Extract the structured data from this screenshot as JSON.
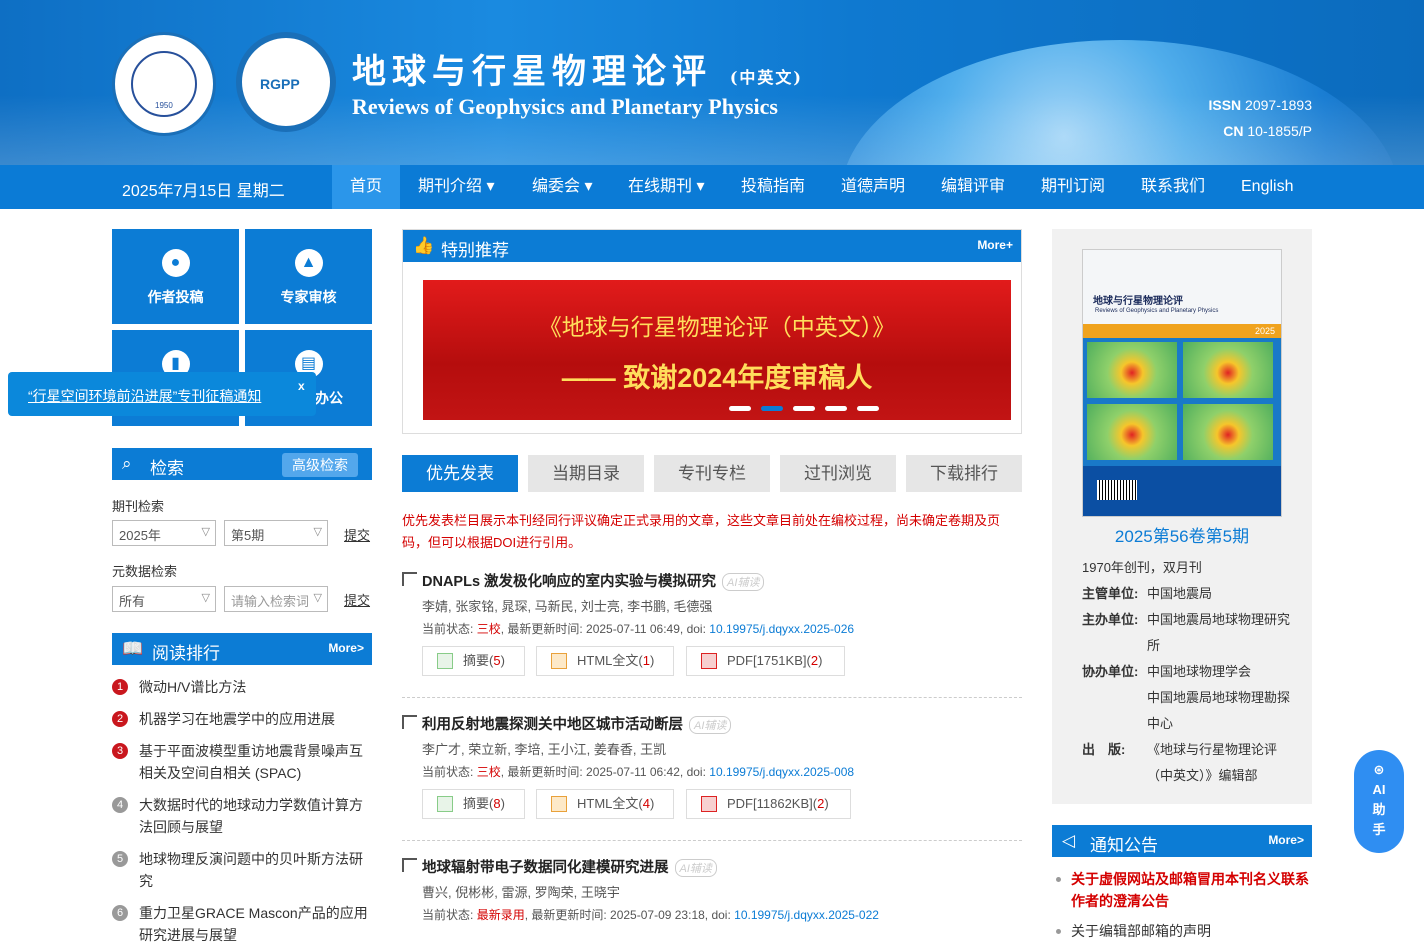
{
  "header": {
    "title_cn": "地球与行星物理论评",
    "title_cn_suffix": "(中英文)",
    "title_en": "Reviews of Geophysics and Planetary Physics",
    "logo_text": "RGPP",
    "seal_year": "1950",
    "issn_label": "ISSN",
    "issn_value": "2097-1893",
    "cn_label": "CN",
    "cn_value": "10-1855/P"
  },
  "nav": {
    "date": "2025年7月15日 星期二",
    "items": [
      "首页",
      "期刊介绍 ▾",
      "编委会 ▾",
      "在线期刊 ▾",
      "投稿指南",
      "道德声明",
      "编辑评审",
      "期刊订阅",
      "联系我们",
      "English"
    ]
  },
  "quick_tiles": [
    "作者投稿",
    "专家审核",
    "",
    "办公"
  ],
  "popup": {
    "text": "“行星空间环境前沿进展”专刊征稿通知",
    "close": "x"
  },
  "search": {
    "title": "检索",
    "advanced": "高级检索",
    "period_label": "期刊检索",
    "year_value": "2025年",
    "issue_value": "第5期",
    "submit": "提交",
    "meta_label": "元数据检索",
    "field_value": "所有",
    "keyword_placeholder": "请输入检索词",
    "submit2": "提交"
  },
  "reading_rank": {
    "title": "阅读排行",
    "more": "More>",
    "items": [
      {
        "n": "1",
        "t": "微动H/V谱比方法"
      },
      {
        "n": "2",
        "t": "机器学习在地震学中的应用进展"
      },
      {
        "n": "3",
        "t": "基于平面波模型重访地震背景噪声互相关及空间自相关 (SPAC)"
      },
      {
        "n": "4",
        "t": "大数据时代的地球动力学数值计算方法回顾与展望"
      },
      {
        "n": "5",
        "t": "地球物理反演问题中的贝叶斯方法研究"
      },
      {
        "n": "6",
        "t": "重力卫星GRACE Mascon产品的应用研究进展与展望"
      }
    ]
  },
  "featured": {
    "title": "特别推荐",
    "more": "More+",
    "slide_line1": "《地球与行星物理论评（中英文）》",
    "slide_line2": "—— 致谢2024年度审稿人"
  },
  "tabs": [
    "优先发表",
    "当期目录",
    "专刊专栏",
    "过刊浏览",
    "下载排行"
  ],
  "notice": "优先发表栏目展示本刊经同行评议确定正式录用的文章，这些文章目前处在编校过程，尚未确定卷期及页码，但可以根据DOI进行引用。",
  "articles": [
    {
      "title": "DNAPLs 激发极化响应的室内实验与模拟研究",
      "ai": "AI辅读",
      "authors": "李婧, 张家铭, 晁琛, 马新民, 刘士亮, 李书鹏, 毛德强",
      "status_label": "当前状态:",
      "status": "三校",
      "updated": ", 最新更新时间: 2025-07-11 06:49, doi:",
      "doi": "10.19975/j.dqyxx.2025-026",
      "abs_label": "摘要(",
      "abs_count": "5",
      "html_label": "HTML全文(",
      "html_count": "1",
      "pdf_label": "PDF[1751KB](",
      "pdf_count": "2"
    },
    {
      "title": "利用反射地震探测关中地区城市活动断层",
      "ai": "AI辅读",
      "authors": "李广才, 荣立新, 李培, 王小江, 姜春香, 王凯",
      "status_label": "当前状态:",
      "status": "三校",
      "updated": ", 最新更新时间: 2025-07-11 06:42, doi:",
      "doi": "10.19975/j.dqyxx.2025-008",
      "abs_label": "摘要(",
      "abs_count": "8",
      "html_label": "HTML全文(",
      "html_count": "4",
      "pdf_label": "PDF[11862KB](",
      "pdf_count": "2"
    },
    {
      "title": "地球辐射带电子数据同化建模研究进展",
      "ai": "AI辅读",
      "authors": "曹兴, 倪彬彬, 雷源, 罗陶荣, 王晓宇",
      "status_label": "当前状态:",
      "status": "最新录用",
      "updated": ", 最新更新时间: 2025-07-09 23:18, doi:",
      "doi": "10.19975/j.dqyxx.2025-022"
    }
  ],
  "cover": {
    "issue": "2025第56卷第5期",
    "cover_title": "地球与行星物理论评",
    "cover_en": "Reviews of Geophysics and Planetary Physics",
    "cover_year": "2025",
    "founded": "1970年创刊，双月刊",
    "info": [
      {
        "k": "主管单位:",
        "v": "中国地震局"
      },
      {
        "k": "主办单位:",
        "v": "中国地震局地球物理研究所"
      },
      {
        "k": "协办单位:",
        "v": "中国地球物理学会"
      },
      {
        "k": "",
        "v": "中国地震局地球物理勘探中心"
      },
      {
        "k": "出　版:",
        "v": "《地球与行星物理论评（中英文）》编辑部"
      }
    ]
  },
  "announcements": {
    "title": "通知公告",
    "more": "More>",
    "items": [
      "关于虚假网站及邮箱冒用本刊名义联系作者的澄清公告",
      "关于编辑部邮箱的声明"
    ]
  },
  "ai_helper": "AI助手",
  "colors": {
    "primary": "#0c7cd5",
    "accent_red": "#c9171e"
  }
}
